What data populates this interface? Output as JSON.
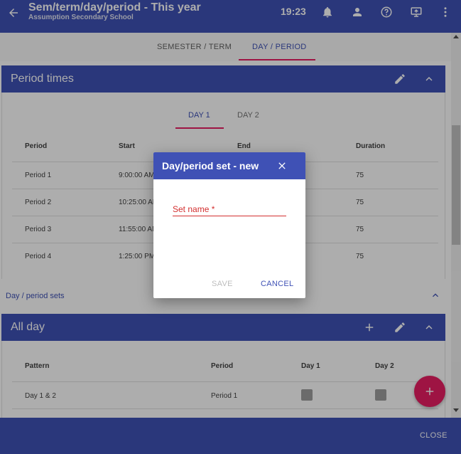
{
  "appbar": {
    "title": "Sem/term/day/period - This year",
    "subtitle": "Assumption Secondary School",
    "time": "19:23",
    "icons": [
      "back-arrow-icon",
      "bell-icon",
      "person-icon",
      "help-icon",
      "screen-share-icon",
      "more-vert-icon"
    ]
  },
  "tabs": [
    "SEMESTER / TERM",
    "DAY / PERIOD"
  ],
  "period_times": {
    "title": "Period times",
    "day_tabs": [
      "DAY 1",
      "DAY 2"
    ],
    "columns": [
      "Period",
      "Start",
      "End",
      "Duration"
    ],
    "rows": [
      {
        "period": "Period 1",
        "start": "9:00:00 AM",
        "duration": "75"
      },
      {
        "period": "Period 2",
        "start": "10:25:00 AM",
        "duration": "75"
      },
      {
        "period": "Period 3",
        "start": "11:55:00 AM",
        "duration": "75"
      },
      {
        "period": "Period 4",
        "start": "1:25:00 PM",
        "duration": "75"
      }
    ]
  },
  "sets_section": {
    "label": "Day / period sets"
  },
  "all_day": {
    "title": "All day",
    "columns": [
      "Pattern",
      "Period",
      "Day 1",
      "Day 2"
    ],
    "rows": [
      {
        "pattern": "Day 1 & 2",
        "period": "Period 1"
      }
    ]
  },
  "dialog": {
    "title": "Day/period set - new",
    "field_label": "Set name",
    "required_mark": " *",
    "field_value": "",
    "save_label": "SAVE",
    "cancel_label": "CANCEL"
  },
  "bottombar": {
    "close_label": "CLOSE"
  },
  "colors": {
    "primary": "#3f51b5",
    "accent": "#e91e63",
    "error": "#d32f2f"
  }
}
